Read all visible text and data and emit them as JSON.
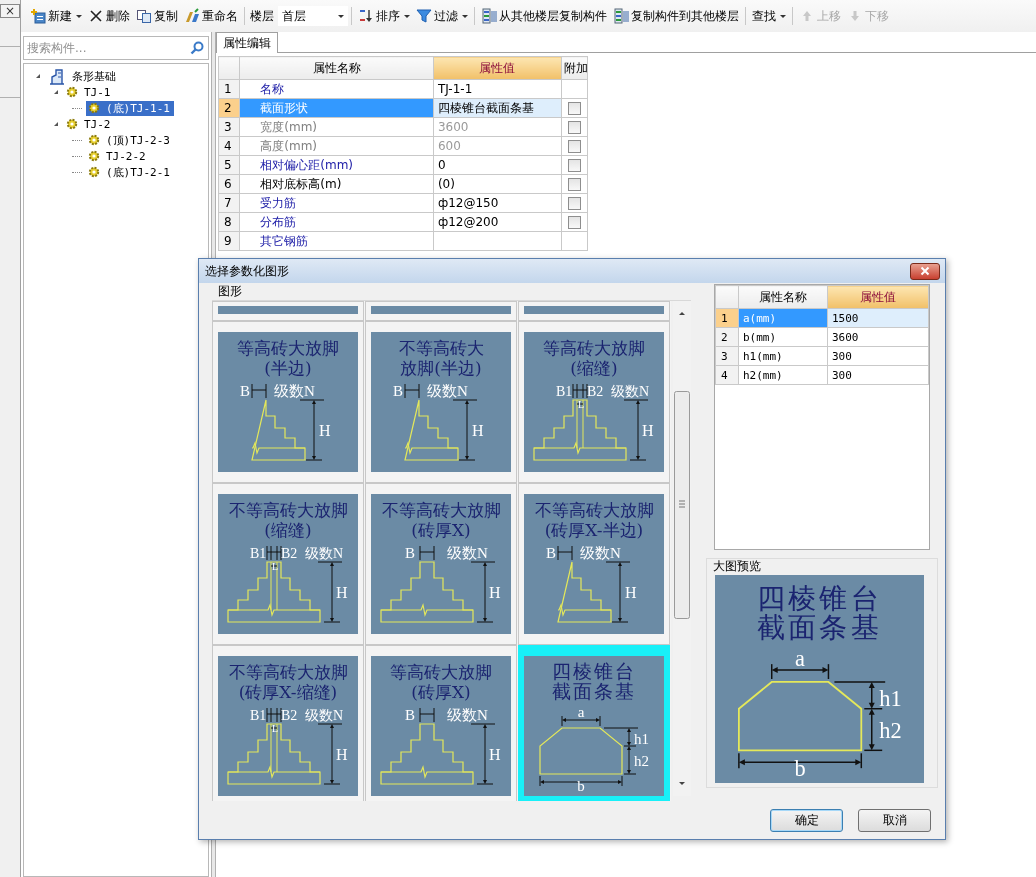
{
  "left_strip": {
    "close_label": "×"
  },
  "toolbar": [
    {
      "kind": "button",
      "label": "新建",
      "dropdown": true,
      "disabled": false
    },
    {
      "kind": "button",
      "label": "删除",
      "dropdown": false,
      "disabled": false
    },
    {
      "kind": "button",
      "label": "复制",
      "dropdown": false,
      "disabled": false
    },
    {
      "kind": "button",
      "label": "重命名",
      "dropdown": false,
      "disabled": false
    },
    {
      "kind": "separator"
    },
    {
      "kind": "label",
      "label": "楼层"
    },
    {
      "kind": "select",
      "value": "首层"
    },
    {
      "kind": "separator"
    },
    {
      "kind": "button",
      "label": "排序",
      "dropdown": true,
      "disabled": false
    },
    {
      "kind": "button",
      "label": "过滤",
      "dropdown": true,
      "disabled": false
    },
    {
      "kind": "separator"
    },
    {
      "kind": "button",
      "label": "从其他楼层复制构件",
      "dropdown": false,
      "disabled": false
    },
    {
      "kind": "button",
      "label": "复制构件到其他楼层",
      "dropdown": false,
      "disabled": false
    },
    {
      "kind": "separator"
    },
    {
      "kind": "button",
      "label": "查找",
      "dropdown": true,
      "disabled": false
    },
    {
      "kind": "separator"
    },
    {
      "kind": "button",
      "label": "上移",
      "dropdown": false,
      "disabled": true
    },
    {
      "kind": "button",
      "label": "下移",
      "dropdown": false,
      "disabled": true
    }
  ],
  "search": {
    "placeholder": "搜索构件..."
  },
  "tree": [
    {
      "label": "条形基础",
      "expanded": true,
      "selected": false,
      "children": [
        {
          "label": "TJ-1",
          "expanded": true,
          "selected": false,
          "children": [
            {
              "label": "(底)TJ-1-1",
              "selected": true
            }
          ]
        },
        {
          "label": "TJ-2",
          "expanded": true,
          "selected": false,
          "children": [
            {
              "label": "(顶)TJ-2-3",
              "selected": false
            },
            {
              "label": "TJ-2-2",
              "selected": false
            },
            {
              "label": "(底)TJ-2-1",
              "selected": false
            }
          ]
        }
      ]
    }
  ],
  "tabs": [
    {
      "label": "属性编辑",
      "selected": true
    }
  ],
  "property_table": {
    "columns": [
      {
        "label": "属性名称",
        "highlighted": false
      },
      {
        "label": "属性值",
        "highlighted": true
      },
      {
        "label": "附加",
        "highlighted": false
      }
    ],
    "rows": [
      {
        "number": "1",
        "name": "名称",
        "value": "TJ-1-1",
        "kind": "public",
        "disabled": false,
        "selected": false
      },
      {
        "number": "2",
        "name": "截面形状",
        "value": "四棱锥台截面条基",
        "kind": "public",
        "disabled": false,
        "selected": true,
        "checked": false
      },
      {
        "number": "3",
        "name": "宽度(mm)",
        "value": "3600",
        "kind": "public",
        "disabled": true,
        "selected": false,
        "checked": false
      },
      {
        "number": "4",
        "name": "高度(mm)",
        "value": "600",
        "kind": "public",
        "disabled": true,
        "selected": false,
        "checked": false
      },
      {
        "number": "5",
        "name": "相对偏心距(mm)",
        "value": "0",
        "kind": "public",
        "disabled": false,
        "selected": false,
        "checked": false
      },
      {
        "number": "6",
        "name": "相对底标高(m)",
        "value": " (0)",
        "kind": "private",
        "disabled": false,
        "selected": false,
        "checked": false
      },
      {
        "number": "7",
        "name": "受力筋",
        "value": "ф12@150",
        "kind": "public",
        "disabled": false,
        "selected": false,
        "checked": false
      },
      {
        "number": "8",
        "name": "分布筋",
        "value": "ф12@200",
        "kind": "public",
        "disabled": false,
        "selected": false,
        "checked": false
      },
      {
        "number": "9",
        "name": "其它钢筋",
        "kind": "public",
        "disabled": false,
        "selected": false
      }
    ]
  },
  "dialog": {
    "title": "选择参数化图形",
    "group_label": "图形",
    "tiles": [
      {
        "kind": "clipped",
        "selected": false
      },
      {
        "kind": "clipped",
        "selected": false
      },
      {
        "kind": "clipped",
        "selected": false
      },
      {
        "kind": "half",
        "title": [
          "等高砖大放脚",
          "(半边)"
        ],
        "labels": [
          "B",
          "级数N",
          "H"
        ],
        "selected": false
      },
      {
        "kind": "half",
        "title": [
          "不等高砖大",
          "放脚(半边)"
        ],
        "labels": [
          "B",
          "级数N",
          "H"
        ],
        "selected": false
      },
      {
        "kind": "joint",
        "title": [
          "等高砖大放脚",
          "(缩缝)"
        ],
        "labels": [
          "B1",
          "L",
          "B2",
          "级数N",
          "H"
        ],
        "selected": false
      },
      {
        "kind": "joint",
        "title": [
          "不等高砖大放脚",
          "(缩缝)"
        ],
        "labels": [
          "B1",
          "L",
          "B2",
          "级数N",
          "H"
        ],
        "selected": false
      },
      {
        "kind": "full",
        "title": [
          "不等高砖大放脚",
          "(砖厚X)"
        ],
        "labels": [
          "B",
          "级数N",
          "H"
        ],
        "selected": false
      },
      {
        "kind": "half",
        "title": [
          "不等高砖大放脚",
          "(砖厚X-半边)"
        ],
        "labels": [
          "B",
          "级数N",
          "H"
        ],
        "selected": false
      },
      {
        "kind": "joint",
        "title": [
          "不等高砖大放脚",
          "(砖厚X-缩缝)"
        ],
        "labels": [
          "B1",
          "L",
          "B2",
          "级数N",
          "H"
        ],
        "selected": false
      },
      {
        "kind": "full",
        "title": [
          "等高砖大放脚",
          "(砖厚X)"
        ],
        "labels": [
          "B",
          "级数N",
          "H"
        ],
        "selected": false
      },
      {
        "kind": "trapezoid",
        "title": [
          "四棱锥台",
          "截面条基"
        ],
        "labels": [
          "a",
          "h1",
          "h2",
          "b"
        ],
        "selected": true
      }
    ],
    "param_table": {
      "columns": [
        {
          "label": "属性名称",
          "highlighted": false
        },
        {
          "label": "属性值",
          "highlighted": true
        }
      ],
      "rows": [
        {
          "number": "1",
          "name": "a(mm)",
          "value": "1500",
          "selected": true
        },
        {
          "number": "2",
          "name": "b(mm)",
          "value": "3600",
          "selected": false
        },
        {
          "number": "3",
          "name": "h1(mm)",
          "value": "300",
          "selected": false
        },
        {
          "number": "4",
          "name": "h2(mm)",
          "value": "300",
          "selected": false
        }
      ]
    },
    "preview_label": "大图预览",
    "preview": {
      "kind": "trapezoid",
      "title": [
        "四棱锥台",
        "截面条基"
      ],
      "labels": [
        "a",
        "h1",
        "h2",
        "b"
      ]
    },
    "buttons": [
      {
        "label": "确定",
        "default": true
      },
      {
        "label": "取消",
        "default": false
      }
    ]
  }
}
